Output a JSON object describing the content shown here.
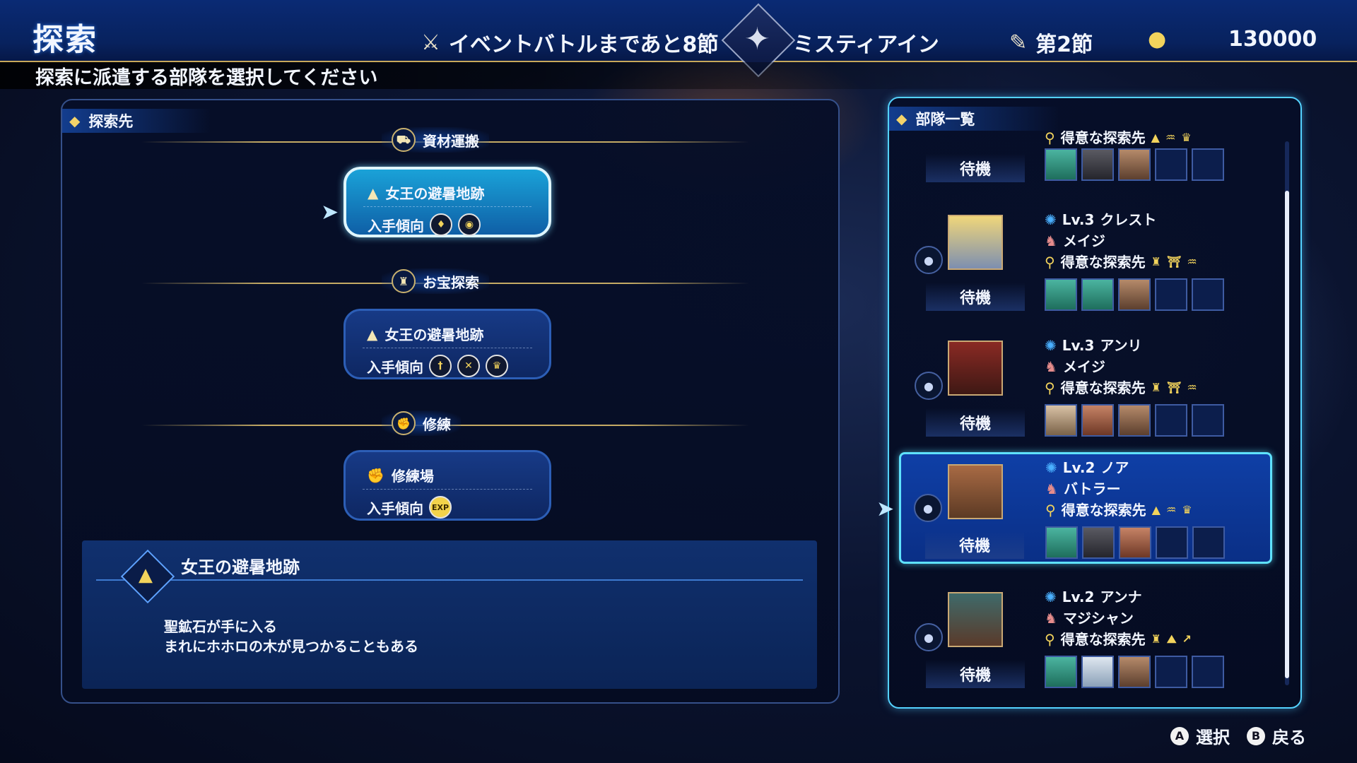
{
  "header": {
    "title": "探索",
    "event_text": "イベントバトルまであと8節",
    "faction": "ミスティアイン",
    "turn": "第2節",
    "gold": "130000",
    "icons": {
      "event": "crossed-swords-icon",
      "emblem": "crest-emblem-icon",
      "turn": "scroll-icon",
      "gold": "coin-stack-icon"
    }
  },
  "subtitle": "探索に派遣する部隊を選択してください",
  "left": {
    "tab_label": "探索先",
    "categories": [
      {
        "label": "資材運搬",
        "icon": "cart-icon"
      },
      {
        "label": "お宝探索",
        "icon": "treasure-bag-icon"
      },
      {
        "label": "修練",
        "icon": "muscle-arm-icon"
      }
    ],
    "cards": [
      {
        "name": "女王の避暑地跡",
        "trend_label": "入手傾向",
        "tokens": [
          "crystal",
          "ore"
        ],
        "selected": true
      },
      {
        "name": "女王の避暑地跡",
        "trend_label": "入手傾向",
        "tokens": [
          "sword",
          "dagger",
          "armor"
        ],
        "selected": false
      },
      {
        "name": "修練場",
        "trend_label": "入手傾向",
        "tokens": [
          "EXP"
        ],
        "selected": false
      }
    ],
    "description": {
      "title": "女王の避暑地跡",
      "lines": [
        "聖鉱石が手に入る",
        "まれにホホロの木が見つかることもある"
      ]
    }
  },
  "right": {
    "tab_label": "部隊一覧",
    "teams": [
      {
        "level": "",
        "name": "",
        "class": "",
        "skill_label": "得意な探索先",
        "status": "待機",
        "selected": false,
        "partial": true,
        "members": [
          "g",
          "d",
          "b"
        ]
      },
      {
        "level": "Lv.3",
        "name": "クレスト",
        "class": "メイジ",
        "skill_label": "得意な探索先",
        "status": "待機",
        "selected": false,
        "members": [
          "g",
          "g",
          "b"
        ]
      },
      {
        "level": "Lv.3",
        "name": "アンリ",
        "class": "メイジ",
        "skill_label": "得意な探索先",
        "status": "待機",
        "selected": false,
        "members": [
          "p",
          "r",
          "b"
        ]
      },
      {
        "level": "Lv.2",
        "name": "ノア",
        "class": "バトラー",
        "skill_label": "得意な探索先",
        "status": "待機",
        "selected": true,
        "members": [
          "g",
          "d",
          "r"
        ]
      },
      {
        "level": "Lv.2",
        "name": "アンナ",
        "class": "マジシャン",
        "skill_label": "得意な探索先",
        "status": "待機",
        "selected": false,
        "members": [
          "g",
          "w",
          "b"
        ]
      }
    ]
  },
  "footer": {
    "a_button": "A",
    "a_label": "選択",
    "b_button": "B",
    "b_label": "戻る"
  }
}
